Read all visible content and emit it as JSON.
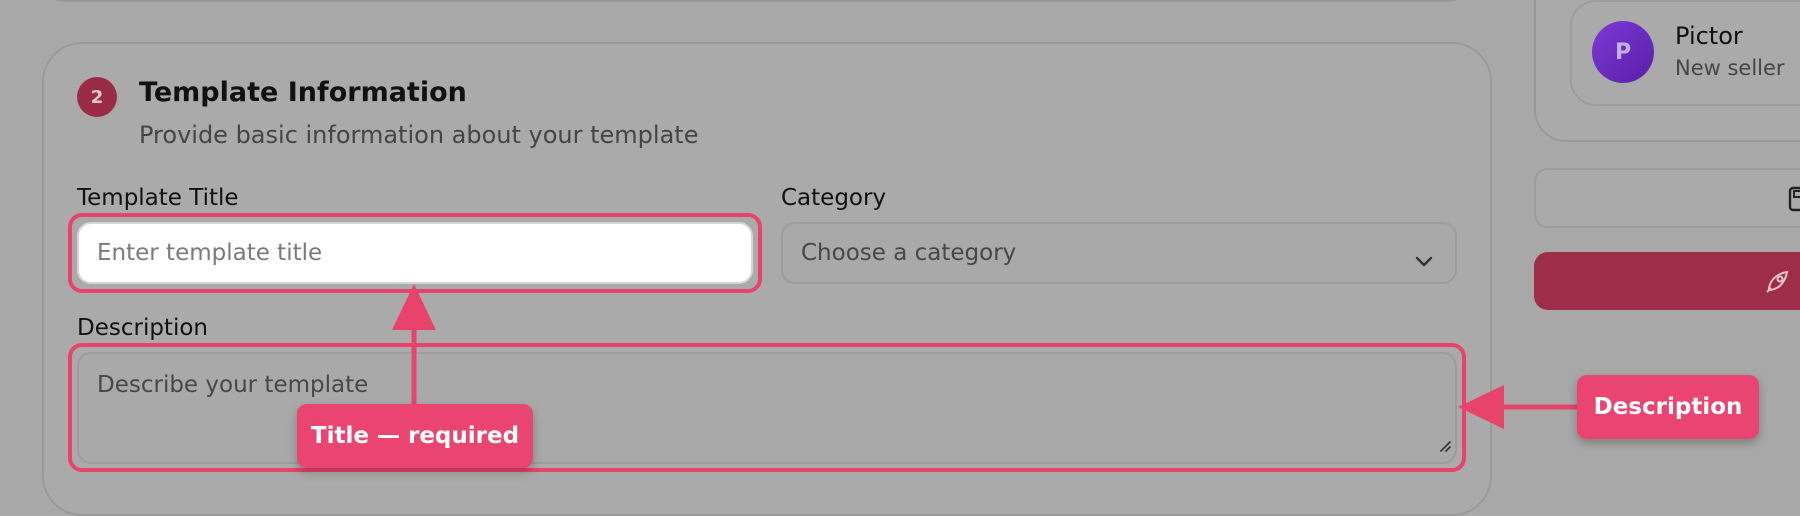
{
  "section": {
    "step_number": "2",
    "title": "Template Information",
    "subtitle": "Provide basic information about your template"
  },
  "fields": {
    "title_label": "Template Title",
    "title_placeholder": "Enter template title",
    "category_label": "Category",
    "category_selected": "Choose a category",
    "description_label": "Description",
    "description_placeholder": "Describe your template"
  },
  "seller": {
    "avatar_initial": "P",
    "name": "Pictor",
    "status": "New seller"
  },
  "annotations": {
    "title_callout": "Title — required",
    "description_callout": "Description"
  },
  "colors": {
    "highlight": "#e8436b",
    "primary": "#9e2d47",
    "avatar": "#6b2ec4"
  },
  "icons": {
    "category_chevron": "chevron-down-icon",
    "save": "save-icon",
    "publish": "rocket-icon"
  }
}
